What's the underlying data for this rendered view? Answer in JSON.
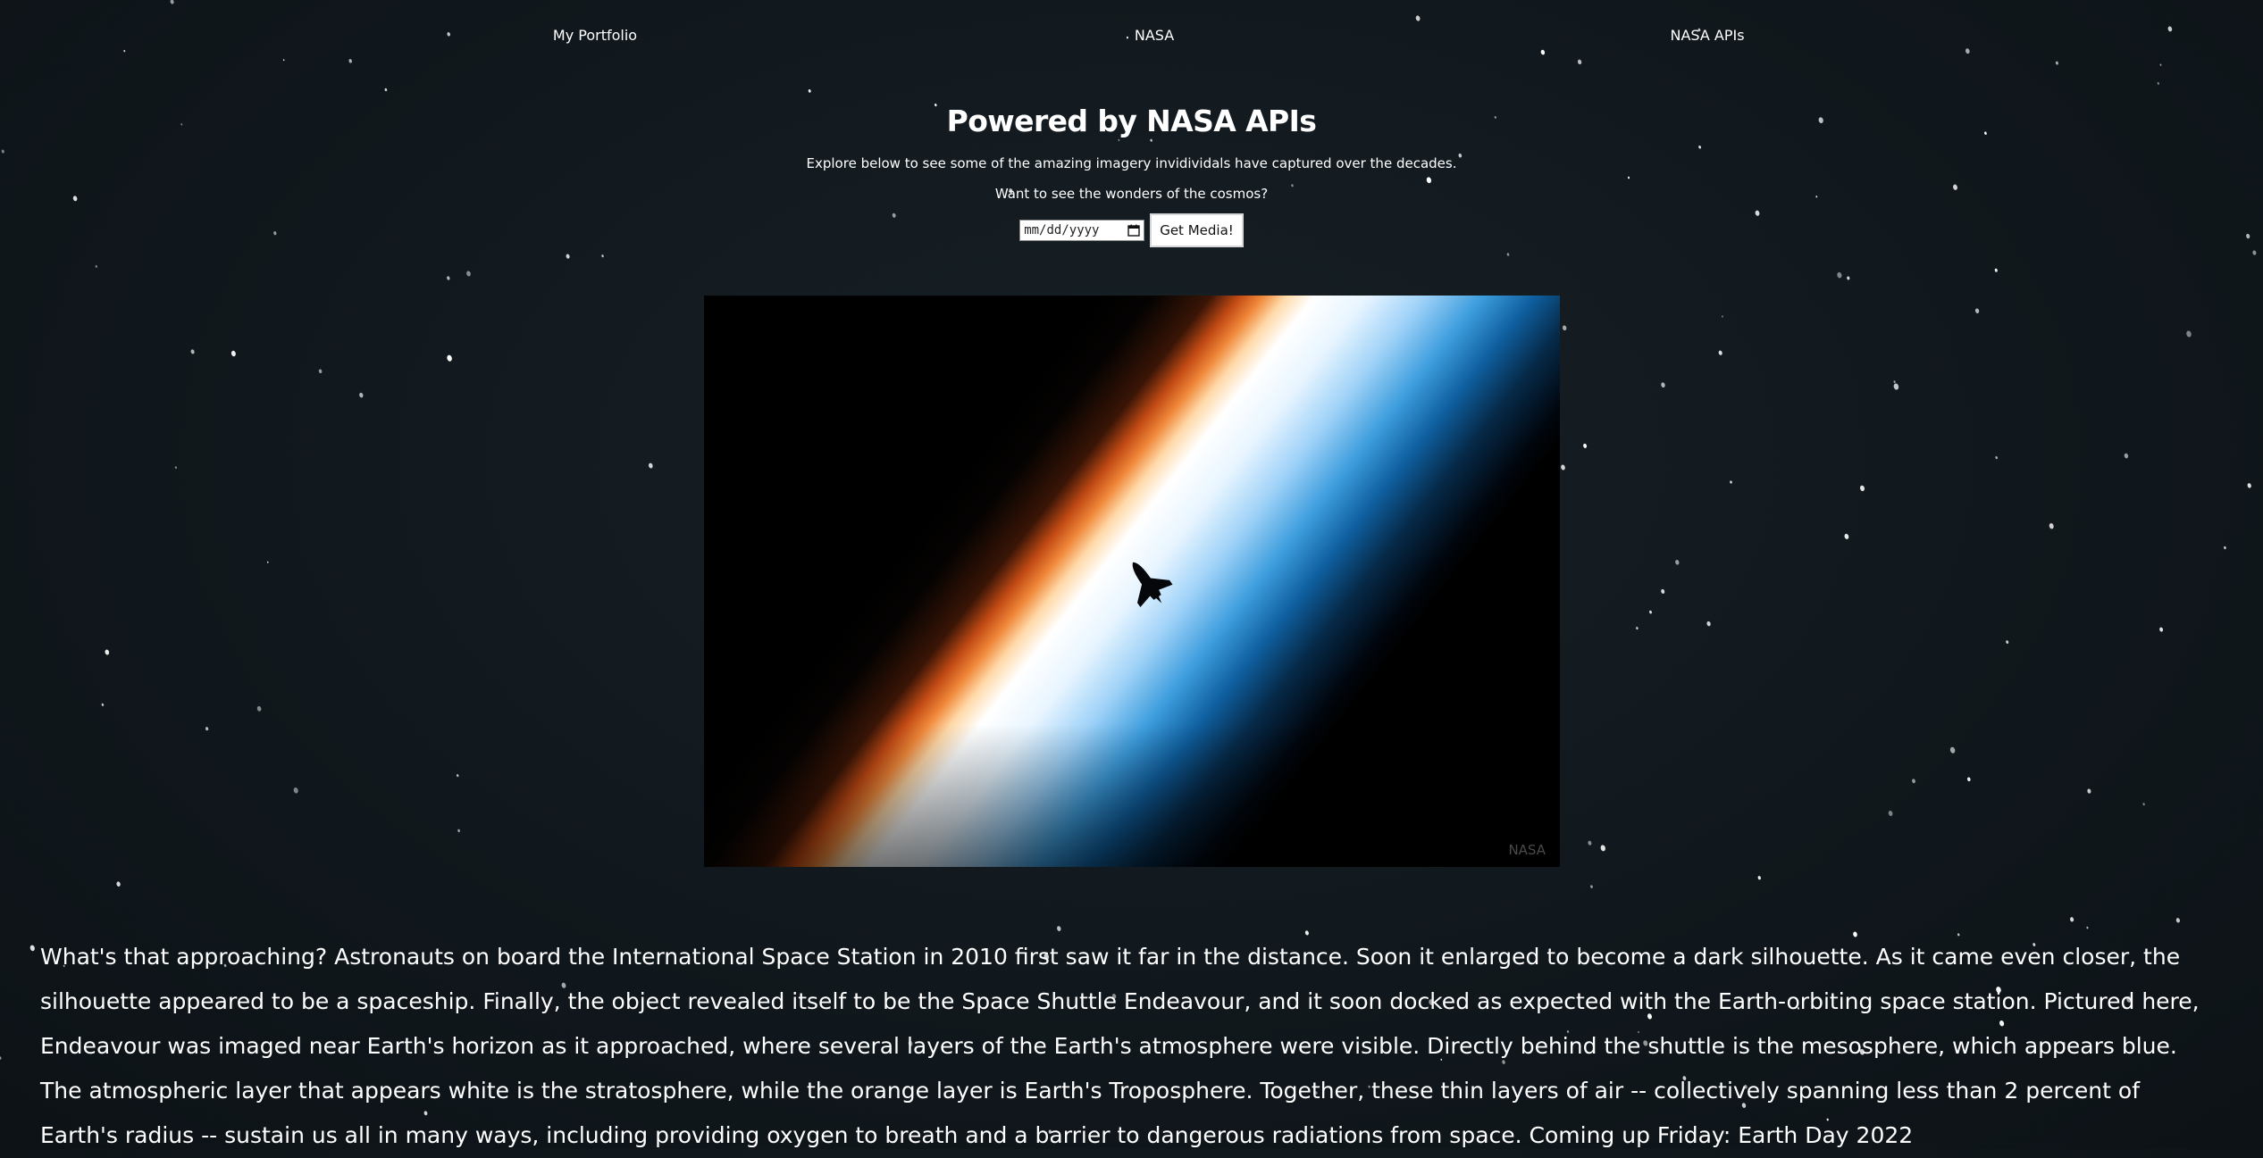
{
  "nav": {
    "items": [
      {
        "label": "My Portfolio"
      },
      {
        "label": "NASA"
      },
      {
        "label": "NASA APIs"
      }
    ]
  },
  "hero": {
    "title": "Powered by NASA APIs",
    "subtitle": "Explore below to see some of the amazing imagery invidividals have captured over the decades.",
    "prompt": "Want to see the wonders of the cosmos?"
  },
  "form": {
    "date_placeholder": "mm/dd/yyyy",
    "submit_label": "Get Media!"
  },
  "media": {
    "credit": "NASA",
    "icon": "space-shuttle-photo"
  },
  "explanation": "What's that approaching? Astronauts on board the International Space Station in 2010 first saw it far in the distance. Soon it enlarged to become a dark silhouette. As it came even closer, the silhouette appeared to be a spaceship. Finally, the object revealed itself to be the Space Shuttle Endeavour, and it soon docked as expected with the Earth-orbiting space station. Pictured here, Endeavour was imaged near Earth's horizon as it approached, where several layers of the Earth's atmosphere were visible. Directly behind the shuttle is the mesosphere, which appears blue. The atmospheric layer that appears white is the stratosphere, while the orange layer is Earth's Troposphere. Together, these thin layers of air -- collectively spanning less than 2 percent of Earth's radius -- sustain us all in many ways, including providing oxygen to breath and a barrier to dangerous radiations from space. Coming up Friday: Earth Day 2022",
  "colors": {
    "background": "#11181d",
    "text": "#ffffff"
  }
}
